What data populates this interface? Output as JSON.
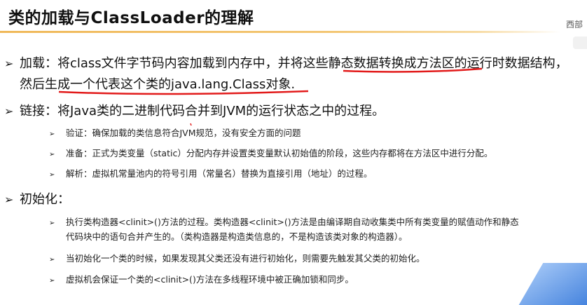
{
  "title": "类的加载与ClassLoader的理解",
  "corner_text": "西部",
  "sections": {
    "loading": {
      "bullet": "➢",
      "line1": "加载：将class文件字节码内容加载到内存中，并将这些静态数据转换成方法区的运行时数据结构，",
      "line2": "然后生成一个代表这个类的java.lang.Class对象."
    },
    "linking": {
      "bullet": "➢",
      "heading": "链接：将Java类的二进制代码合并到JVM的运行状态之中的过程。",
      "items": [
        "验证：确保加载的类信息符合JVM规范，没有安全方面的问题",
        "准备：正式为类变量（static）分配内存并设置类变量默认初始值的阶段，这些内存都将在方法区中进行分配。",
        "解析：虚拟机常量池内的符号引用（常量名）替换为直接引用（地址）的过程。"
      ]
    },
    "init": {
      "bullet": "➢",
      "heading": "初始化：",
      "items": [
        "执行类构造器<clinit>()方法的过程。类构造器<clinit>()方法是由编译期自动收集类中所有类变量的赋值动作和静态",
        "代码块中的语句合并产生的。（类构造器是构造类信息的，不是构造该类对象的构造器）。",
        "当初始化一个类的时候，如果发现其父类还没有进行初始化，则需要先触发其父类的初始化。",
        "虚拟机会保证一个类的<clinit>()方法在多线程环境中被正确加锁和同步。"
      ]
    }
  },
  "sub_bullet": "➢"
}
